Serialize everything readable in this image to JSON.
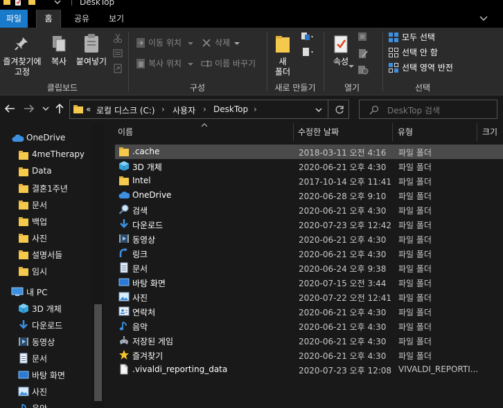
{
  "window": {
    "title": "DeskTop"
  },
  "menu": {
    "tabs": [
      "파일",
      "홈",
      "공유",
      "보기"
    ]
  },
  "ribbon": {
    "clipboard": {
      "pin_label_1": "즐겨찾기에",
      "pin_label_2": "고정",
      "copy_label": "복사",
      "paste_label": "붙여넣기",
      "group_label": "클립보드"
    },
    "organize": {
      "move_to": "이동 위치",
      "copy_to": "복사 위치",
      "delete": "삭제",
      "rename": "이름 바꾸기",
      "group_label": "구성"
    },
    "new": {
      "new_folder_1": "새",
      "new_folder_2": "폴더",
      "group_label": "새로 만들기"
    },
    "open": {
      "properties": "속성",
      "group_label": "열기"
    },
    "select": {
      "select_all": "모두 선택",
      "select_none": "선택 안 함",
      "invert": "선택 영역 반전",
      "group_label": "선택"
    }
  },
  "address": {
    "prefix": "«",
    "crumbs": [
      "로컬 디스크 (C:)",
      "사용자",
      "DeskTop"
    ],
    "search_placeholder": "DeskTop 검색"
  },
  "sidebar": {
    "onedrive": "OneDrive",
    "onedrive_items": [
      "4meTherapy",
      "Data",
      "결혼1주년",
      "문서",
      "백업",
      "사진",
      "설명서들",
      "임시"
    ],
    "pc": "내 PC",
    "pc_items": [
      "3D 개체",
      "다운로드",
      "동영상",
      "문서",
      "바탕 화면",
      "사진",
      "음악"
    ]
  },
  "columns": {
    "name": "이름",
    "modified": "수정한 날짜",
    "type": "유형",
    "size": "크기"
  },
  "files": [
    {
      "name": ".cache",
      "modified": "2018-03-11 오전 4:16",
      "type": "파일 폴더",
      "icon": "folder-icon",
      "selected": true
    },
    {
      "name": "3D 개체",
      "modified": "2020-06-21 오후 4:30",
      "type": "파일 폴더",
      "icon": "3d-objects-icon"
    },
    {
      "name": "Intel",
      "modified": "2017-10-14 오후 11:41",
      "type": "파일 폴더",
      "icon": "folder-icon"
    },
    {
      "name": "OneDrive",
      "modified": "2020-06-28 오후 9:10",
      "type": "파일 폴더",
      "icon": "onedrive-icon"
    },
    {
      "name": "검색",
      "modified": "2020-06-21 오후 4:30",
      "type": "파일 폴더",
      "icon": "search-icon"
    },
    {
      "name": "다운로드",
      "modified": "2020-07-23 오후 12:42",
      "type": "파일 폴더",
      "icon": "download-icon"
    },
    {
      "name": "동영상",
      "modified": "2020-06-21 오후 4:30",
      "type": "파일 폴더",
      "icon": "video-icon"
    },
    {
      "name": "링크",
      "modified": "2020-06-21 오후 4:30",
      "type": "파일 폴더",
      "icon": "link-icon"
    },
    {
      "name": "문서",
      "modified": "2020-06-24 오후 9:38",
      "type": "파일 폴더",
      "icon": "document-icon"
    },
    {
      "name": "바탕 화면",
      "modified": "2020-07-15 오전 3:44",
      "type": "파일 폴더",
      "icon": "desktop-icon"
    },
    {
      "name": "사진",
      "modified": "2020-07-22 오전 12:41",
      "type": "파일 폴더",
      "icon": "picture-icon"
    },
    {
      "name": "연락처",
      "modified": "2020-06-21 오후 4:30",
      "type": "파일 폴더",
      "icon": "contacts-icon"
    },
    {
      "name": "음악",
      "modified": "2020-06-21 오후 4:30",
      "type": "파일 폴더",
      "icon": "music-icon"
    },
    {
      "name": "저장된 게임",
      "modified": "2020-06-21 오후 4:30",
      "type": "파일 폴더",
      "icon": "saved-games-icon"
    },
    {
      "name": "즐겨찾기",
      "modified": "2020-06-21 오후 4:30",
      "type": "파일 폴더",
      "icon": "favorites-icon"
    },
    {
      "name": ".vivaldi_reporting_data",
      "modified": "2020-07-23 오후 12:08",
      "type": "VIVALDI_REPORTI...",
      "icon": "file-icon"
    }
  ],
  "colors": {
    "accent": "#1979ca",
    "folder": "#f4c94c",
    "selection": "#4a4a4a",
    "background": "#191919",
    "ribbon": "#2b2b2b"
  }
}
